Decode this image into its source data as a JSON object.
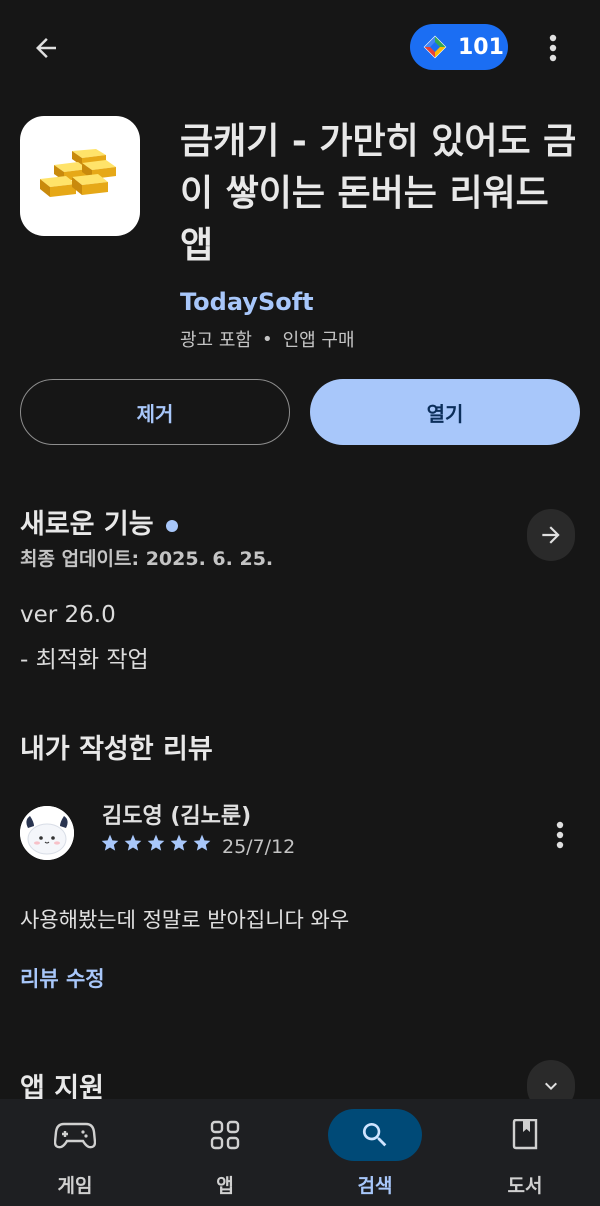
{
  "top_bar": {
    "points_value": "101",
    "icons": {
      "back": "arrow-back-icon",
      "points": "play-points-icon",
      "more": "more-vert-icon"
    }
  },
  "app": {
    "title": "금캐기 - 가만히 있어도 금이 쌓이는 돈버는 리워드 앱",
    "developer": "TodaySoft",
    "meta": {
      "ads": "광고 포함",
      "separator": "•",
      "iap": "인앱 구매"
    },
    "icon": "gold-bars-icon"
  },
  "actions": {
    "uninstall_label": "제거",
    "open_label": "열기"
  },
  "whats_new": {
    "title": "새로운 기능",
    "updated": "최종 업데이트: 2025. 6. 25.",
    "version": "ver 26.0",
    "changes": "- 최적화 작업"
  },
  "my_review": {
    "section_title": "내가 작성한 리뷰",
    "reviewer": "김도영 (김노룬)",
    "rating": 5,
    "date": "25/7/12",
    "text": "사용해봤는데 정말로 받아집니다 와우",
    "edit_label": "리뷰 수정"
  },
  "app_support": {
    "title": "앱 지원"
  },
  "bottom_nav": {
    "items": [
      {
        "label": "게임",
        "icon": "gamepad-icon",
        "active": false
      },
      {
        "label": "앱",
        "icon": "apps-grid-icon",
        "active": false
      },
      {
        "label": "검색",
        "icon": "search-icon",
        "active": true
      },
      {
        "label": "도서",
        "icon": "book-icon",
        "active": false
      }
    ]
  },
  "colors": {
    "background": "#161616",
    "accent": "#a8c7fa",
    "points_chip": "#1b6ef3",
    "nav_active_pill": "#004a77"
  }
}
